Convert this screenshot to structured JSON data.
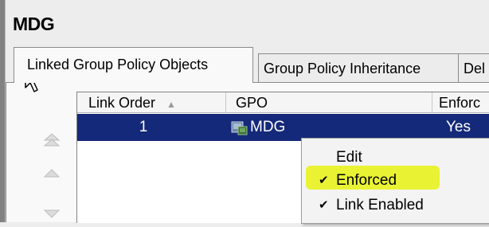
{
  "header": {
    "title": "MDG"
  },
  "tabs": [
    {
      "label": "Linked Group Policy Objects",
      "active": true
    },
    {
      "label": "Group Policy Inheritance",
      "active": false
    },
    {
      "label": "Del",
      "active": false
    }
  ],
  "table": {
    "columns": [
      "Link Order",
      "GPO",
      "Enforc"
    ],
    "sort_indicator": "▲",
    "rows": [
      {
        "link_order": "1",
        "gpo": "MDG",
        "enforced": "Yes",
        "selected": true
      }
    ]
  },
  "side_buttons": [
    {
      "icon": "move-top-icon",
      "glyph": "⩯"
    },
    {
      "icon": "move-up-icon",
      "glyph": "▲"
    },
    {
      "icon": "move-down-icon",
      "glyph": "▼"
    }
  ],
  "context_menu": {
    "items": [
      {
        "label": "Edit",
        "checked": false
      },
      {
        "label": "Enforced",
        "checked": true,
        "highlighted": true
      },
      {
        "label": "Link Enabled",
        "checked": true
      }
    ],
    "check_glyph": "✔"
  },
  "colors": {
    "selection": "#15297a",
    "highlight": "#e6f212",
    "window_bg": "#ededed"
  }
}
